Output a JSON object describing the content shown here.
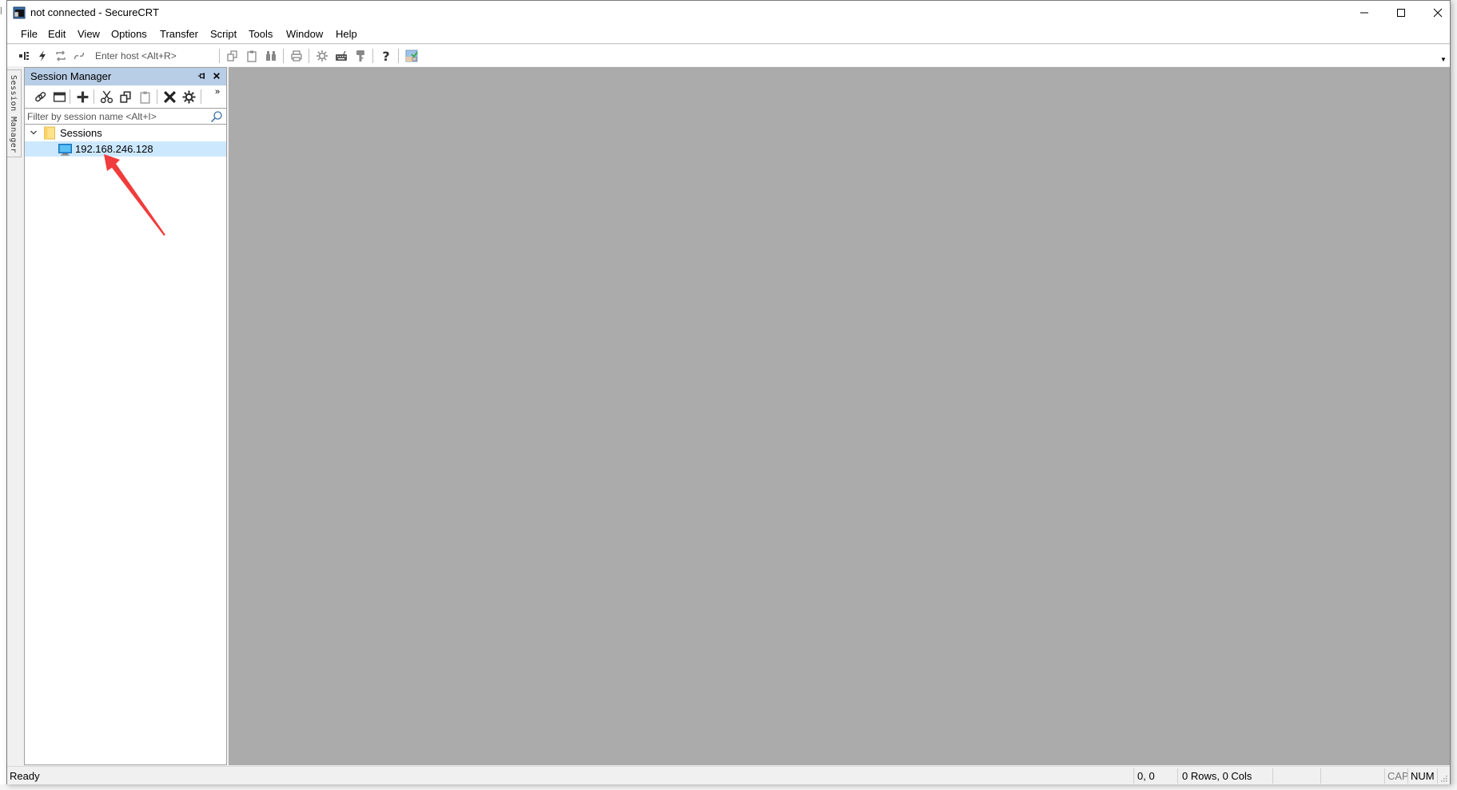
{
  "window": {
    "title": "not connected - SecureCRT",
    "controls": {
      "minimize": "minimize",
      "maximize": "maximize",
      "close": "close"
    }
  },
  "menu": {
    "items": [
      "File",
      "Edit",
      "View",
      "Options",
      "Transfer",
      "Script",
      "Tools",
      "Window",
      "Help"
    ]
  },
  "toolbar": {
    "host_placeholder": "Enter host <Alt+R>",
    "icons": [
      "connect-in-tab-icon",
      "quick-connect-icon",
      "reconnect-icon",
      "disconnect-icon",
      "copy-icon",
      "paste-icon",
      "find-icon",
      "print-icon",
      "session-options-icon",
      "keymap-icon",
      "key-icon",
      "help-icon",
      "sftp-icon"
    ]
  },
  "side_tab": {
    "label": "Session Manager"
  },
  "session_manager": {
    "title": "Session Manager",
    "toolbar_icons": [
      "link-icon",
      "new-tab-icon",
      "add-icon",
      "cut-icon",
      "copy-icon",
      "paste-icon",
      "delete-icon",
      "properties-icon"
    ],
    "more": "»",
    "filter_placeholder": "Filter by session name <Alt+I>",
    "tree": {
      "folder": "Sessions",
      "sessions": [
        {
          "name": "192.168.246.128",
          "selected": true
        }
      ]
    }
  },
  "statusbar": {
    "status": "Ready",
    "cursor": "0, 0",
    "size": "0 Rows, 0 Cols",
    "cap": "CAP",
    "num": "NUM"
  },
  "colors": {
    "panel_header": "#b8cde6",
    "selection": "#cce8ff",
    "workspace": "#ababab",
    "annotation_arrow": "#f03c3c"
  }
}
